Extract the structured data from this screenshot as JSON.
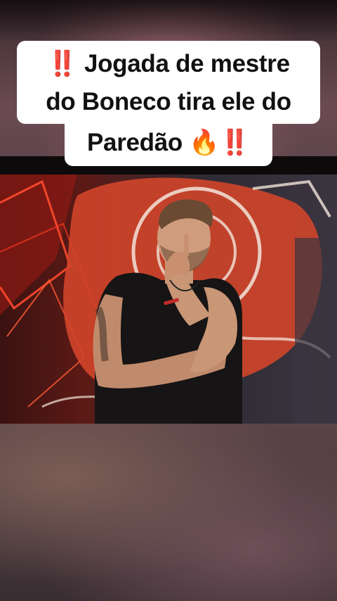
{
  "caption": {
    "line1_prefix": "‼️",
    "line1_text": "Jogada de mestre",
    "line2_text": "do Boneco tira ele do",
    "line3_text": "Paredão 🔥‼️"
  },
  "colors": {
    "caption_bg": "#ffffff",
    "caption_text": "#111111",
    "accent_red": "#e0202a"
  }
}
